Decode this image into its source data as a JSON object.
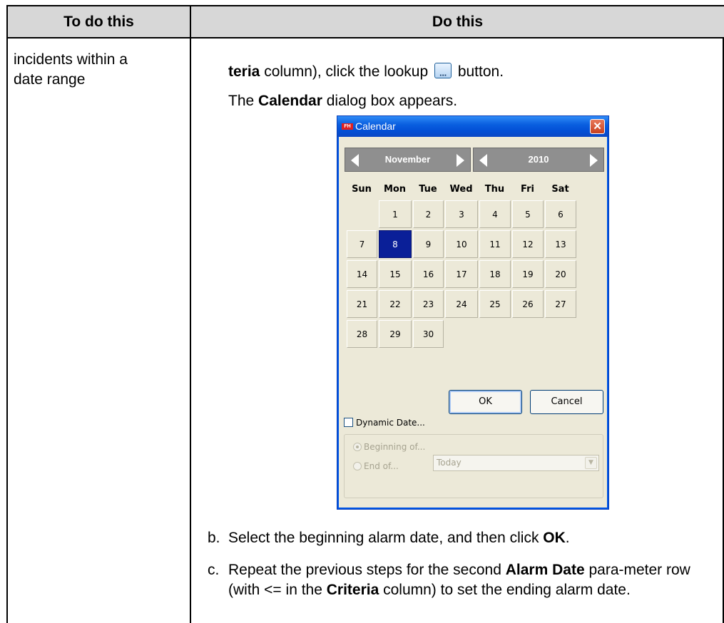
{
  "table": {
    "col_left_header": "To do this",
    "col_right_header": "Do this",
    "left_cell_line1": "incidents within a",
    "left_cell_line2": "date range"
  },
  "instructions": {
    "line1_bold": "teria",
    "line1_pre": " column), click the lookup",
    "line1_post": " button.",
    "line2_pre": "The ",
    "line2_bold": "Calendar",
    "line2_post": " dialog box appears.",
    "step_b_label": "b.",
    "step_b_pre": "Select the beginning alarm date, and then click ",
    "step_b_bold": "OK",
    "step_b_post": ".",
    "step_c_label": "c.",
    "step_c_t1": "Repeat the previous steps for the second ",
    "step_c_b1": "Alarm Date",
    "step_c_t2": " para-meter row (with <= in the ",
    "step_c_b2": "Criteria",
    "step_c_t3": " column) to set the ending alarm date."
  },
  "calendar": {
    "logo_text": "FH",
    "title": "Calendar",
    "close_glyph": "✕",
    "month": "November",
    "year": "2010",
    "weekdays": [
      "Sun",
      "Mon",
      "Tue",
      "Wed",
      "Thu",
      "Fri",
      "Sat"
    ],
    "first_weekday_index": 1,
    "days_in_month": 30,
    "selected_day": 8,
    "ok_label": "OK",
    "cancel_label": "Cancel",
    "dynamic_label": "Dynamic Date...",
    "radio_beginning": "Beginning of...",
    "radio_end": "End of...",
    "select_value": "Today",
    "dropdown_glyph": "▼"
  },
  "icons": [
    "lookup-icon",
    "calendar-logo-icon",
    "close-icon",
    "prev-month-icon",
    "next-month-icon",
    "prev-year-icon",
    "next-year-icon",
    "chevron-down-icon"
  ]
}
